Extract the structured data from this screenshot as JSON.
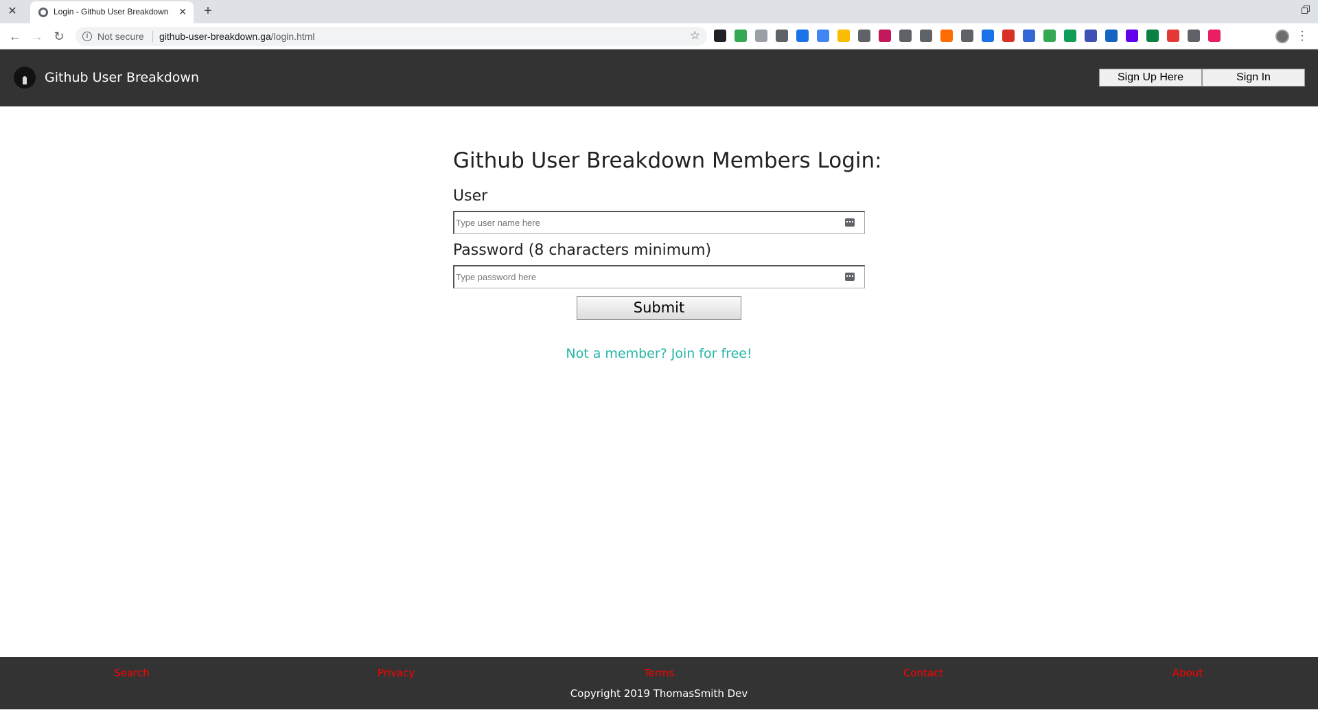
{
  "browser": {
    "tab_title": "Login - Github User Breakdown",
    "security_label": "Not secure",
    "url_domain": "github-user-breakdown.ga",
    "url_path": "/login.html",
    "extension_colors": [
      "#202124",
      "#34a853",
      "#9aa0a6",
      "#5f6368",
      "#1a73e8",
      "#4285f4",
      "#fbbc04",
      "#5f6368",
      "#c2185b",
      "#5f6368",
      "#5f6368",
      "#ff6d00",
      "#5f6368",
      "#1a73e8",
      "#d93025",
      "#3367d6",
      "#34a853",
      "#0f9d58",
      "#3f51b5",
      "#1565c0",
      "#6200ea",
      "#0b8043",
      "#e53935",
      "#5f6368",
      "#e91e63"
    ]
  },
  "header": {
    "site_title": "Github User Breakdown",
    "signup_label": "Sign Up Here",
    "signin_label": "Sign In"
  },
  "login": {
    "title": "Github User Breakdown Members Login:",
    "user_label": "User",
    "user_placeholder": "Type user name here",
    "password_label": "Password (8 characters minimum)",
    "password_placeholder": "Type password here",
    "submit_label": "Submit",
    "join_link": "Not a member? Join for free!"
  },
  "footer": {
    "links": [
      "Search",
      "Privacy",
      "Terms",
      "Contact",
      "About"
    ],
    "copyright": "Copyright 2019 ThomasSmith Dev"
  },
  "colors": {
    "header_bg": "#333333",
    "link_teal": "#22b5a6",
    "footer_link_red": "#ff0000"
  }
}
